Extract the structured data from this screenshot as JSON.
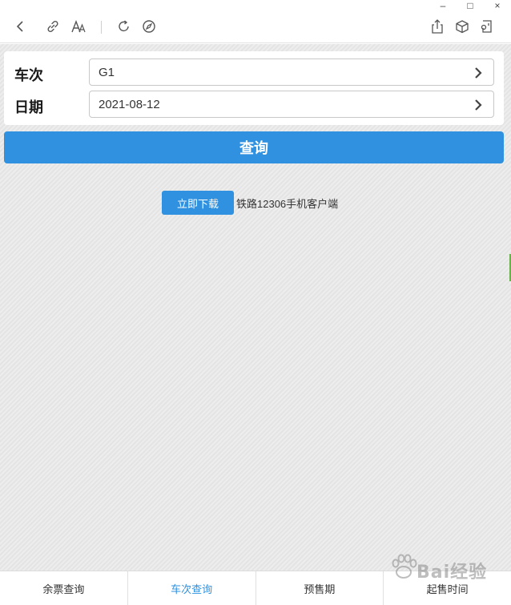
{
  "window": {
    "minimize_glyph": "–",
    "maximize_glyph": "□",
    "close_glyph": "×"
  },
  "toolbar": {
    "icons": [
      "back-icon",
      "link-icon",
      "font-size-icon",
      "refresh-icon",
      "compass-icon",
      "share-icon",
      "cube-icon",
      "extension-icon"
    ]
  },
  "form": {
    "train_label": "车次",
    "train_value": "G1",
    "date_label": "日期",
    "date_value": "2021-08-12"
  },
  "query_button": "查询",
  "download": {
    "button": "立即下载",
    "text": "铁路12306手机客户端"
  },
  "tabs": [
    {
      "label": "余票查询",
      "active": false
    },
    {
      "label": "车次查询",
      "active": true
    },
    {
      "label": "预售期",
      "active": false
    },
    {
      "label": "起售时间",
      "active": false
    }
  ],
  "watermark": {
    "text": "Bai经验"
  },
  "colors": {
    "accent": "#2f91df",
    "background": "#e9e9e9"
  }
}
